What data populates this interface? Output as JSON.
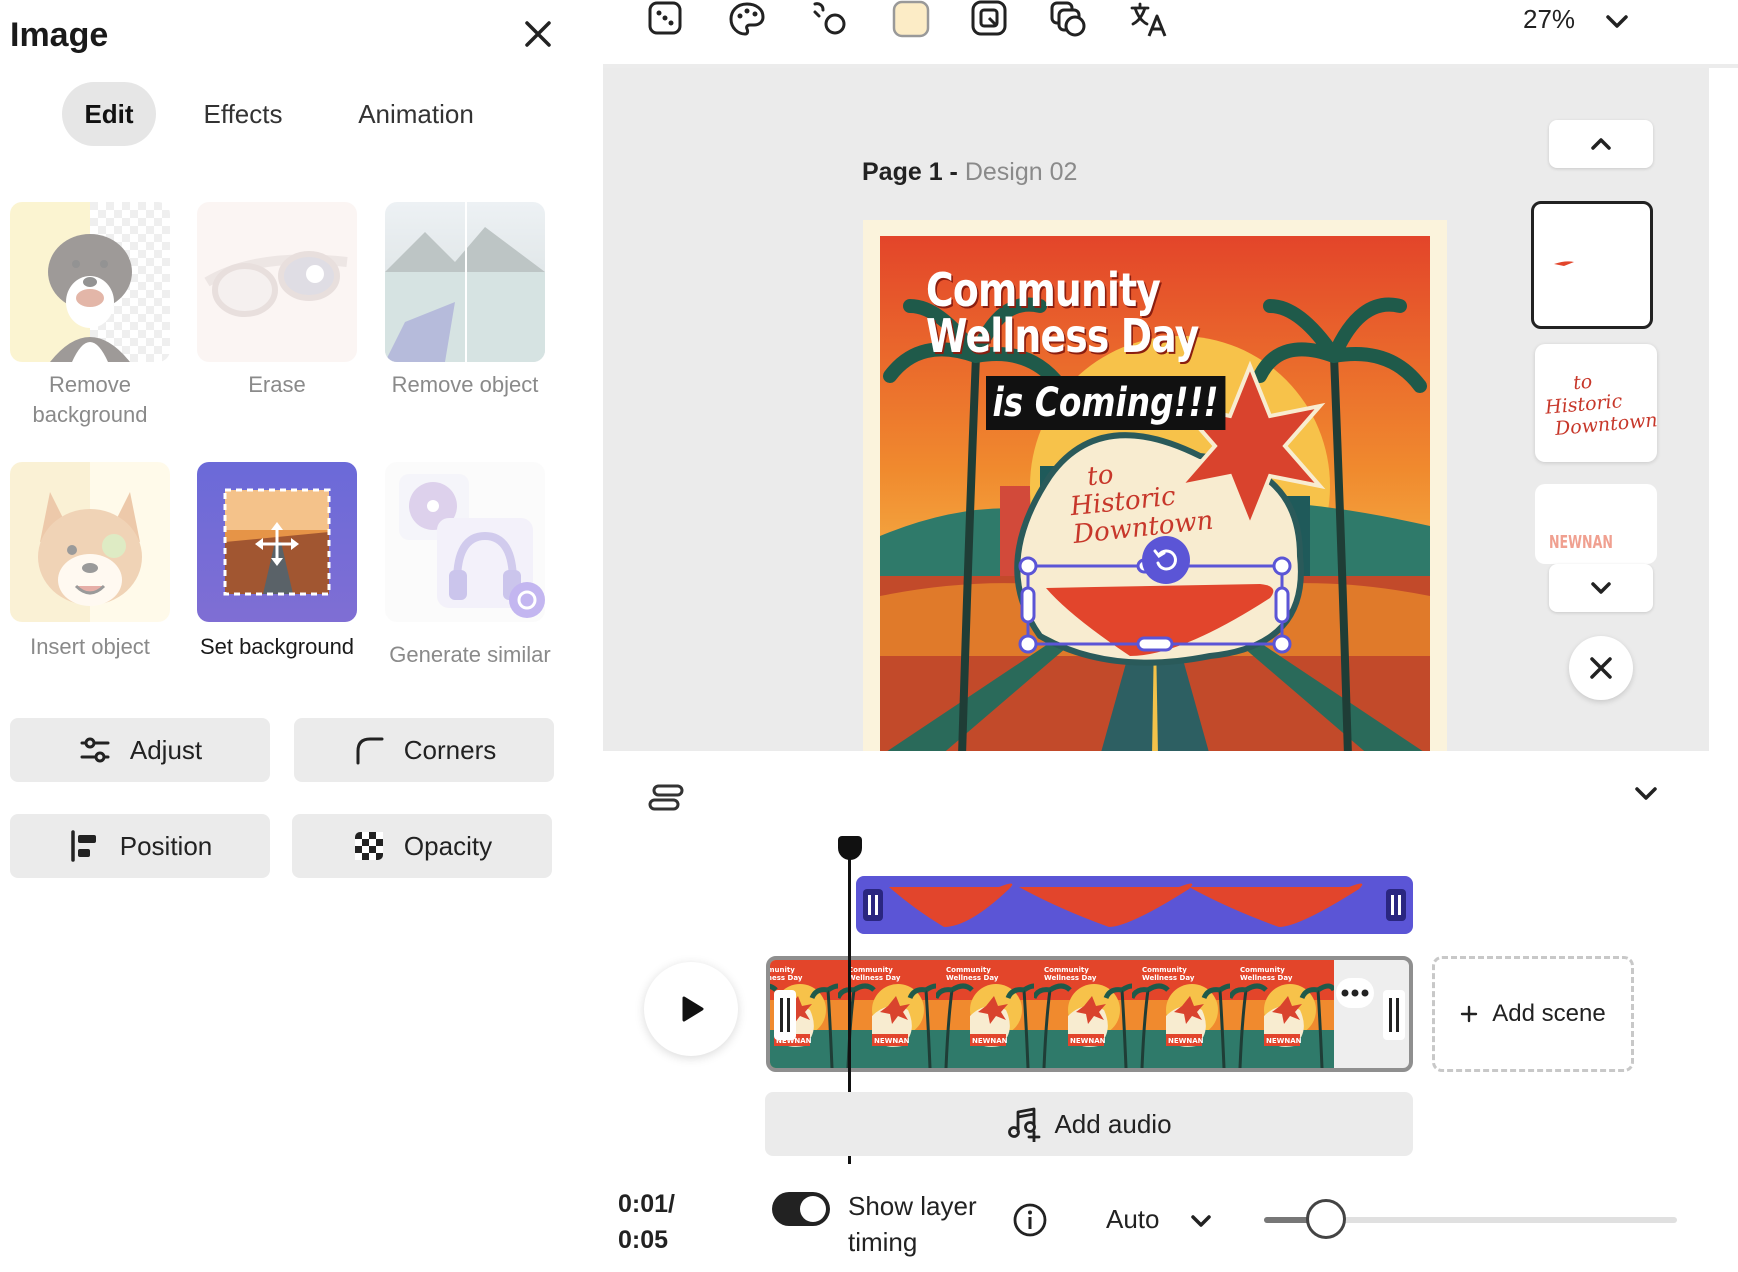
{
  "panel": {
    "title": "Image",
    "tabs": [
      "Edit",
      "Effects",
      "Animation"
    ],
    "active_tab": "Edit",
    "tools": [
      {
        "label": "Remove background",
        "icon": "dog-cutout-icon"
      },
      {
        "label": "Erase",
        "icon": "sunglasses-erase-icon"
      },
      {
        "label": "Remove object",
        "icon": "lake-kayak-icon"
      },
      {
        "label": "Insert object",
        "icon": "shiba-dog-icon"
      },
      {
        "label": "Set background",
        "icon": "road-background-icon"
      },
      {
        "label": "Generate similar",
        "icon": "headphones-generate-icon"
      }
    ],
    "buttons": {
      "adjust": "Adjust",
      "corners": "Corners",
      "position": "Position",
      "opacity": "Opacity"
    }
  },
  "toolbar": {
    "icons": [
      "replace-icon",
      "color-palette-icon",
      "link-shapes-icon",
      "color-swatch-icon",
      "crop-frame-icon",
      "layers-copy-icon",
      "translate-icon"
    ],
    "swatch_color": "#fcecc6",
    "zoom": "27%"
  },
  "canvas": {
    "page_label": "Page 1 -",
    "page_name": "Design 02",
    "poster": {
      "line1": "Community",
      "line2": "Wellness Day",
      "line3": "is Coming!!!",
      "script1": "to",
      "script2": "Historic",
      "script3": "Downtown"
    }
  },
  "pages": {
    "thumb2_line1": "to",
    "thumb2_line2": "Historic",
    "thumb2_line3": "Downtown",
    "thumb3_text": "NEWNAN"
  },
  "timeline": {
    "current_time": "0:01/",
    "total_time": "0:05",
    "show_layer_timing_label": "Show layer timing",
    "show_layer_timing_on": true,
    "speed": "Auto",
    "speed_slider": 0.15,
    "add_scene": "Add scene",
    "add_audio": "Add audio",
    "frame_text": "NEWNAN",
    "frame_title": "Community Wellness Day"
  },
  "colors": {
    "accent": "#5b55d6",
    "poster_red": "#e2452c",
    "poster_orange": "#f59a2c"
  }
}
